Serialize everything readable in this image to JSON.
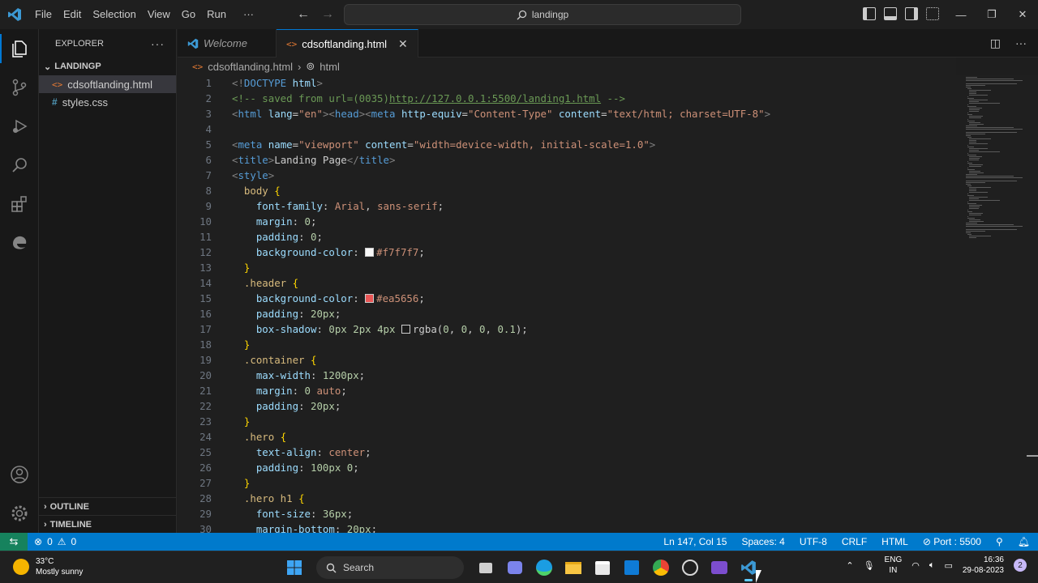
{
  "menu": [
    "File",
    "Edit",
    "Selection",
    "View",
    "Go",
    "Run",
    "···"
  ],
  "search": {
    "text": "landingp"
  },
  "sidebar": {
    "title": "EXPLORER",
    "folder": "LANDINGP",
    "files": [
      "cdsoftlanding.html",
      "styles.css"
    ],
    "outline": "OUTLINE",
    "timeline": "TIMELINE"
  },
  "tabs": [
    {
      "label": "Welcome"
    },
    {
      "label": "cdsoftlanding.html"
    }
  ],
  "breadcrumb": {
    "file": "cdsoftlanding.html",
    "symbol": "html"
  },
  "code": {
    "line_numbers": [
      "1",
      "2",
      "3",
      "4",
      "5",
      "6",
      "7",
      "8",
      "9",
      "10",
      "11",
      "12",
      "13",
      "14",
      "15",
      "16",
      "17",
      "18",
      "19",
      "20",
      "21",
      "22",
      "23",
      "24",
      "25",
      "26",
      "27",
      "28",
      "29",
      "30"
    ],
    "lines": [
      "<!DOCTYPE html>",
      "<!-- saved from url=(0035)http://127.0.0.1:5500/landing1.html -->",
      "<html lang=\"en\"><head><meta http-equiv=\"Content-Type\" content=\"text/html; charset=UTF-8\">",
      "",
      "<meta name=\"viewport\" content=\"width=device-width, initial-scale=1.0\">",
      "<title>Landing Page</title>",
      "<style>",
      "  body {",
      "    font-family: Arial, sans-serif;",
      "    margin: 0;",
      "    padding: 0;",
      "    background-color: #f7f7f7;",
      "  }",
      "  .header {",
      "    background-color: #ea5656;",
      "    padding: 20px;",
      "    box-shadow: 0px 2px 4px rgba(0, 0, 0, 0.1);",
      "  }",
      "  .container {",
      "    max-width: 1200px;",
      "    margin: 0 auto;",
      "    padding: 20px;",
      "  }",
      "  .hero {",
      "    text-align: center;",
      "    padding: 100px 0;",
      "  }",
      "  .hero h1 {",
      "    font-size: 36px;",
      "    margin-bottom: 20px;"
    ]
  },
  "colors": {
    "swatch_white": "#f7f7f7",
    "swatch_red": "#ea5656",
    "swatch_shadow": "#1a1a1a",
    "accent": "#007acc"
  },
  "status": {
    "problems": "0",
    "warnings": "0",
    "position": "Ln 147, Col 15",
    "spaces": "Spaces: 4",
    "encoding": "UTF-8",
    "eol": "CRLF",
    "language": "HTML",
    "port": "Port : 5500"
  },
  "taskbar": {
    "temp": "33°C",
    "weather": "Mostly sunny",
    "search": "Search",
    "lang1": "ENG",
    "lang2": "IN",
    "time": "16:36",
    "date": "29-08-2023",
    "notifications": "2"
  }
}
